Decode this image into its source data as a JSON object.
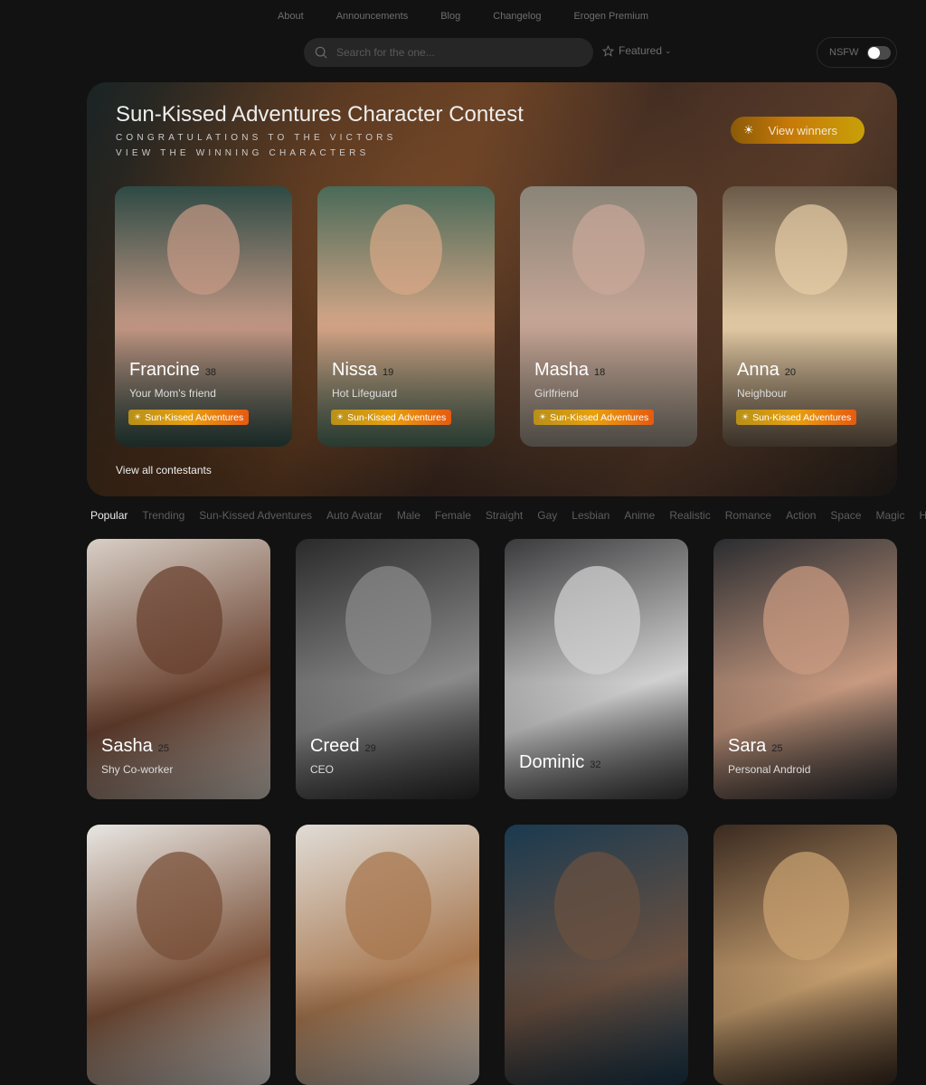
{
  "nav": {
    "links": [
      "About",
      "Announcements",
      "Blog",
      "Changelog",
      "Erogen Premium"
    ]
  },
  "search": {
    "placeholder": "Search for the one...",
    "value": ""
  },
  "filter": {
    "label": "Featured",
    "icon": "star-icon"
  },
  "nsfw": {
    "label": "NSFW",
    "enabled": false
  },
  "contest": {
    "title": "Sun-Kissed Adventures Character Contest",
    "subtitle1": "CONGRATULATIONS TO THE VICTORS",
    "subtitle2": "VIEW THE WINNING CHARACTERS",
    "view_winners": "View winners",
    "view_all": "View all contestants",
    "winners": [
      {
        "name": "Francine",
        "age": "38",
        "role": "Your Mom's friend",
        "badge": "Sun-Kissed Adventures",
        "colors": [
          "#2e4a44",
          "#c79a86"
        ]
      },
      {
        "name": "Nissa",
        "age": "19",
        "role": "Hot Lifeguard",
        "badge": "Sun-Kissed Adventures",
        "colors": [
          "#4a6a58",
          "#d9a888"
        ]
      },
      {
        "name": "Masha",
        "age": "18",
        "role": "Girlfriend",
        "badge": "Sun-Kissed Adventures",
        "colors": [
          "#8a8478",
          "#caa898"
        ]
      },
      {
        "name": "Anna",
        "age": "20",
        "role": "Neighbour",
        "badge": "Sun-Kissed Adventures",
        "colors": [
          "#6a5a48",
          "#e8cfa8"
        ]
      }
    ]
  },
  "tabs": [
    "Popular",
    "Trending",
    "Sun-Kissed Adventures",
    "Auto Avatar",
    "Male",
    "Female",
    "Straight",
    "Gay",
    "Lesbian",
    "Anime",
    "Realistic",
    "Romance",
    "Action",
    "Space",
    "Magic",
    "Ho"
  ],
  "active_tab": "Popular",
  "characters": [
    {
      "name": "Sasha",
      "age": "25",
      "role": "Shy Co-worker",
      "colors": [
        "#d8cfc6",
        "#6a4230"
      ]
    },
    {
      "name": "Creed",
      "age": "29",
      "role": "CEO",
      "colors": [
        "#2a2a2a",
        "#8a8a8a"
      ]
    },
    {
      "name": "Dominic",
      "age": "32",
      "role": "",
      "colors": [
        "#3a3a3c",
        "#d0d0d0"
      ]
    },
    {
      "name": "Sara",
      "age": "25",
      "role": "Personal Android",
      "colors": [
        "#2a2c30",
        "#c89a80"
      ]
    },
    {
      "name": "",
      "age": "",
      "role": "",
      "colors": [
        "#e8e6e2",
        "#7a5038"
      ]
    },
    {
      "name": "",
      "age": "",
      "role": "",
      "colors": [
        "#e0dcd6",
        "#a87850"
      ]
    },
    {
      "name": "",
      "age": "",
      "role": "",
      "colors": [
        "#1a3a50",
        "#6a5040"
      ]
    },
    {
      "name": "",
      "age": "",
      "role": "",
      "colors": [
        "#3a2a20",
        "#c8a070"
      ]
    }
  ]
}
